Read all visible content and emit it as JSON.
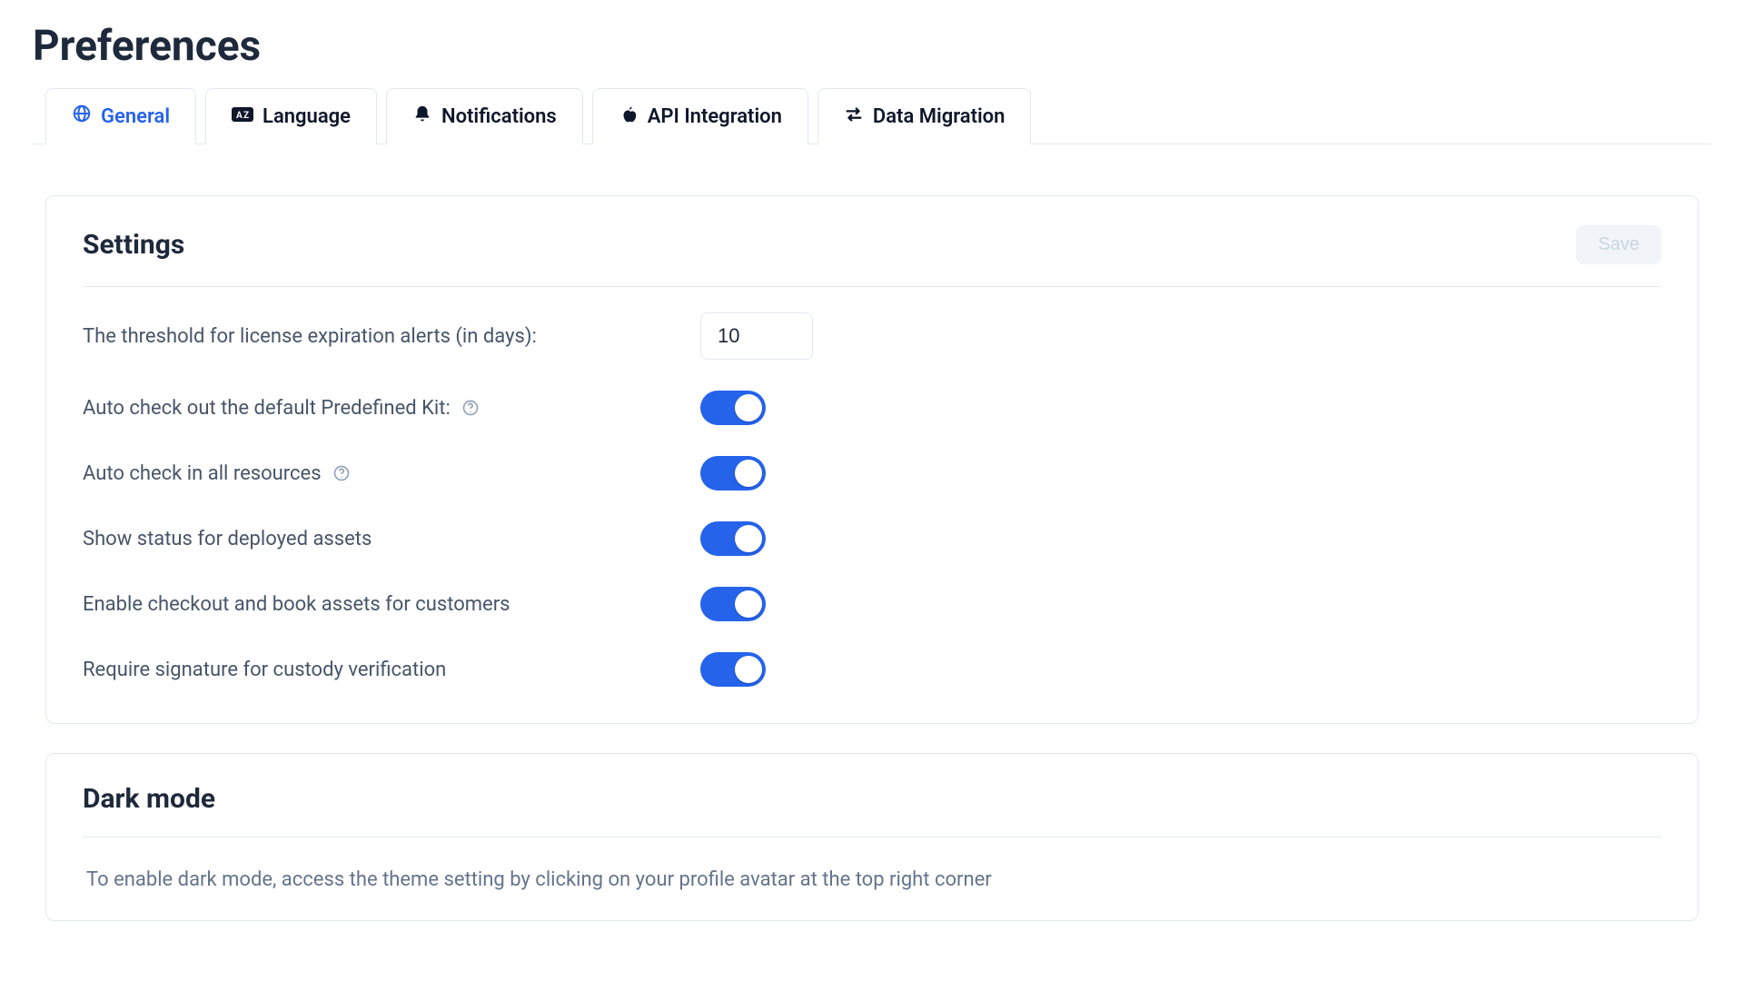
{
  "page": {
    "title": "Preferences"
  },
  "tabs": {
    "general": "General",
    "language": "Language",
    "notifications": "Notifications",
    "api": "API Integration",
    "migration": "Data Migration"
  },
  "settings_card": {
    "title": "Settings",
    "save_label": "Save",
    "threshold_label": "The threshold for license expiration alerts (in days):",
    "threshold_value": "10",
    "auto_checkout_label": "Auto check out the default Predefined Kit:",
    "auto_checkin_label": "Auto check in all resources",
    "deployed_status_label": "Show status for deployed assets",
    "customer_checkout_label": "Enable checkout and book assets for customers",
    "signature_label": "Require signature for custody verification"
  },
  "darkmode_card": {
    "title": "Dark mode",
    "description": "To enable dark mode, access the theme setting by clicking on your profile avatar at the top right corner"
  }
}
